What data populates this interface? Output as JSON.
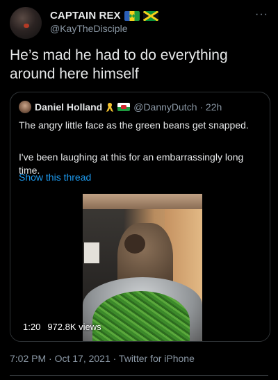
{
  "author": {
    "display_name": "CAPTAIN REX",
    "handle": "@KayTheDisciple",
    "flags": [
      "saint-vincent-flag-icon",
      "jamaica-flag-icon"
    ]
  },
  "tweet": {
    "text": "He’s mad he had to do everything around here himself",
    "more_label": "···"
  },
  "quoted": {
    "display_name": "Daniel Holland",
    "handle_time": "@DannyDutch · 22h",
    "badges": [
      "ribbon-icon",
      "wales-flag-icon"
    ],
    "text_1": "The angry little face as the green beans get snapped.",
    "text_2": "I've been laughing at this for an embarrassingly long time.",
    "show_thread": "Show this thread",
    "video": {
      "duration": "1:20",
      "views": "972.8K views"
    }
  },
  "footer": {
    "timestamp": "7:02 PM · Oct 17, 2021 · Twitter for iPhone"
  },
  "colors": {
    "background": "#000000",
    "text": "#e7e9ea",
    "muted": "#8b98a5",
    "link": "#1d9bf0",
    "border": "#2f3336"
  }
}
